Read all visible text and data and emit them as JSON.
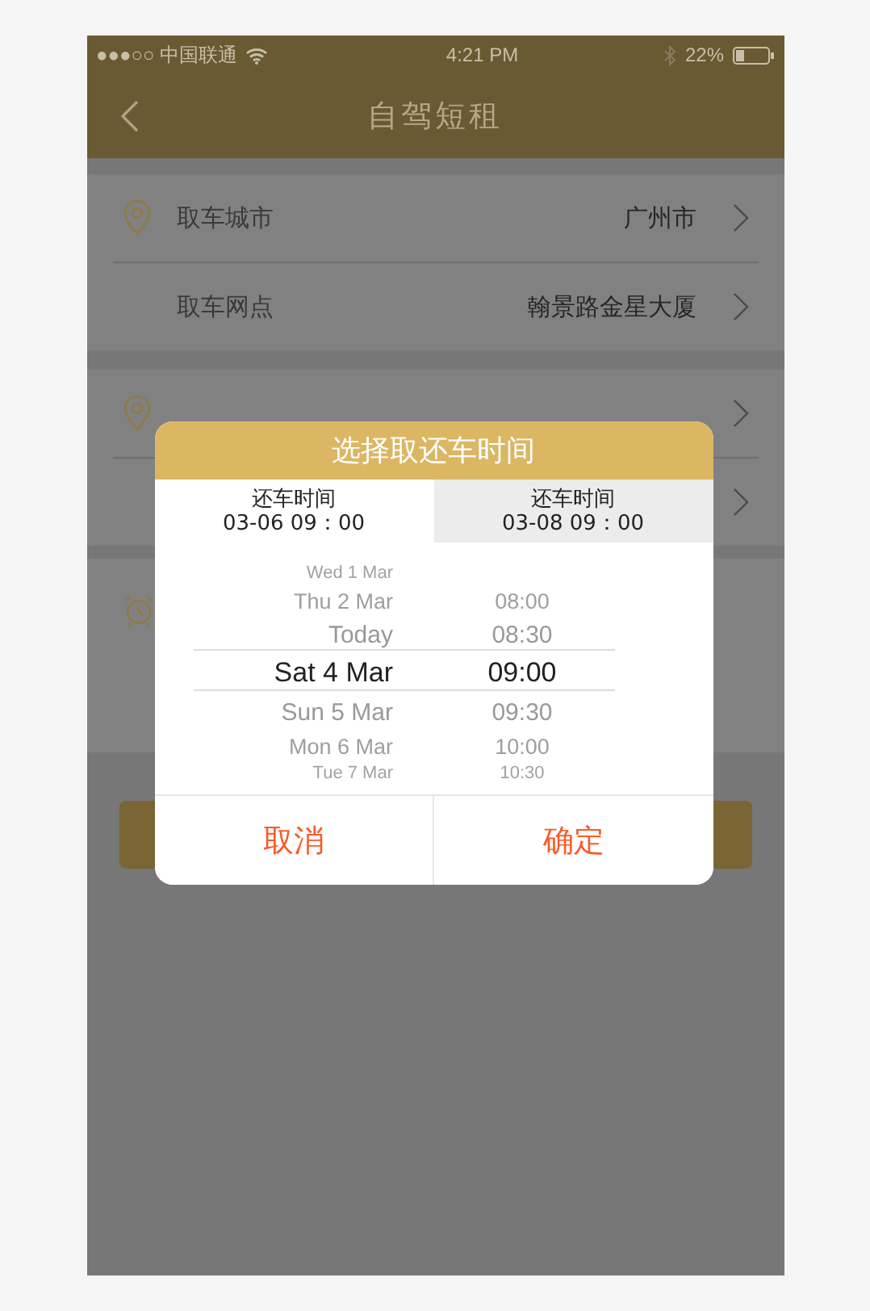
{
  "status_bar": {
    "carrier": "●●●○○ 中国联通",
    "time": "4:21 PM",
    "battery": "22%"
  },
  "nav": {
    "title": "自驾短租"
  },
  "pickup": [
    {
      "label": "取车城市",
      "value": "广州市",
      "icon": true
    },
    {
      "label": "取车网点",
      "value": "翰景路金星大厦",
      "icon": false
    }
  ],
  "modal": {
    "title": "选择取还车时间",
    "tabs": [
      {
        "label": "还车时间",
        "value": "03-06 09：00",
        "selected": true
      },
      {
        "label": "还车时间",
        "value": "03-08 09：00",
        "selected": false
      }
    ],
    "picker": [
      {
        "date": "Wed 1 Mar",
        "selected": false
      },
      {
        "date": "Thu 2 Mar",
        "time": "08:00",
        "selected": false
      },
      {
        "date": "Today",
        "time": "08:30",
        "selected": false
      },
      {
        "date": "Sat 4 Mar",
        "time": "09:00",
        "selected": true
      },
      {
        "date": "Sun 5 Mar",
        "time": "09:30",
        "selected": false
      },
      {
        "date": "Mon 6 Mar",
        "time": "10:00",
        "selected": false
      },
      {
        "date": "Tue 7 Mar",
        "time": "10:30",
        "selected": false
      }
    ],
    "buttons": [
      "取消",
      "确定"
    ]
  }
}
